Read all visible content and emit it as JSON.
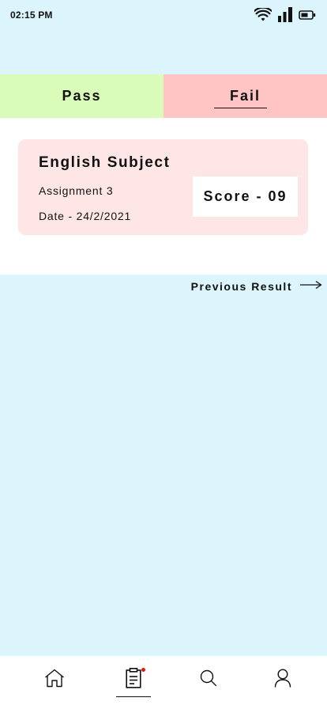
{
  "status_bar": {
    "time": "02:15 PM",
    "icons": [
      "wifi-icon",
      "cellular-signal-icon",
      "battery-icon"
    ]
  },
  "tabs": [
    {
      "label": "Pass",
      "color": "#d9fdb9",
      "active": false
    },
    {
      "label": "Fail",
      "color": "#ffc4c4",
      "active": true
    }
  ],
  "result_card": {
    "subject": "English Subject",
    "assignment": "Assignment 3",
    "date": "Date - 24/2/2021",
    "score": "Score - 09",
    "background": "#ffe6e6"
  },
  "previous_result": {
    "label": "Previous Result",
    "icon": "arrow-right-icon"
  },
  "bottom_nav": {
    "items": [
      {
        "icon": "home-icon",
        "active": false
      },
      {
        "icon": "clipboard-icon",
        "active": true,
        "notification_dot": true
      },
      {
        "icon": "search-icon",
        "active": false
      },
      {
        "icon": "user-icon",
        "active": false
      }
    ]
  },
  "colors": {
    "page_background": "#dcf5fd",
    "notification_dot": "#e01818"
  }
}
